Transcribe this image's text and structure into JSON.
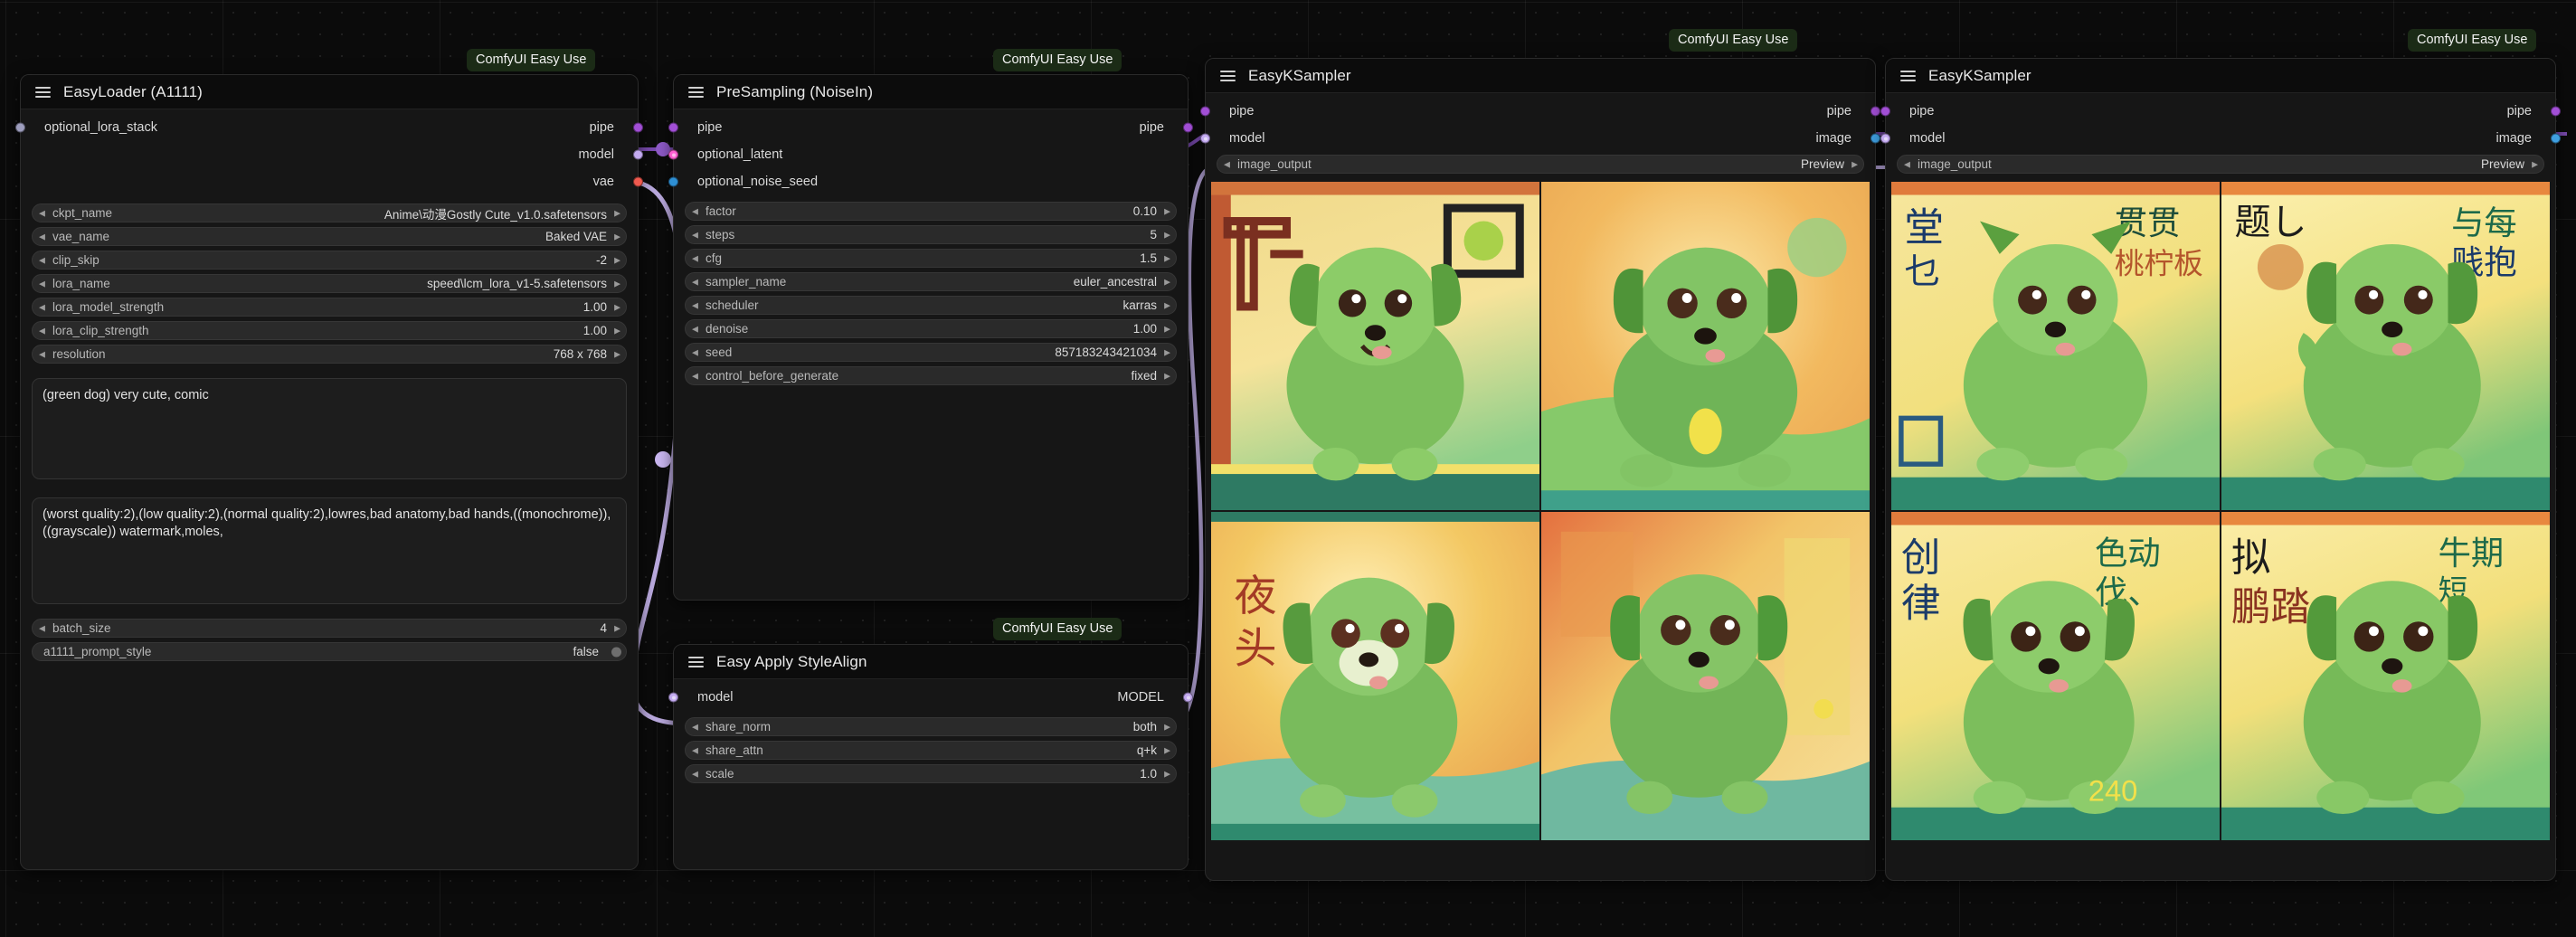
{
  "canvas": {
    "badge_label": "ComfyUI Easy Use"
  },
  "nodes": [
    {
      "id": "easyloader",
      "title": "EasyLoader (A1111)",
      "inputs": [
        {
          "name": "optional_lora_stack",
          "color": "#9d9dbd"
        }
      ],
      "outputs": [
        {
          "name": "pipe",
          "color": "#a24fd6"
        },
        {
          "name": "model",
          "color": "#c3aaf0"
        },
        {
          "name": "vae",
          "color": "#f05a4f"
        }
      ],
      "widgets": [
        {
          "name": "ckpt_name",
          "value": "Anime\\动漫Gostly Cute_v1.0.safetensors"
        },
        {
          "name": "vae_name",
          "value": "Baked VAE"
        },
        {
          "name": "clip_skip",
          "value": "-2"
        },
        {
          "name": "lora_name",
          "value": "speed\\lcm_lora_v1-5.safetensors"
        },
        {
          "name": "lora_model_strength",
          "value": "1.00"
        },
        {
          "name": "lora_clip_strength",
          "value": "1.00"
        },
        {
          "name": "resolution",
          "value": "768 x 768"
        }
      ],
      "positive_prompt": "(green dog) very cute, comic",
      "negative_prompt": "(worst quality:2),(low quality:2),(normal quality:2),lowres,bad anatomy,bad hands,((monochrome)),((grayscale)) watermark,moles,",
      "batch": {
        "name": "batch_size",
        "value": "4"
      },
      "toggle": {
        "name": "a1111_prompt_style",
        "value": "false"
      }
    },
    {
      "id": "presampling",
      "title": "PreSampling (NoiseIn)",
      "inputs": [
        {
          "name": "pipe",
          "color": "#a24fd6"
        },
        {
          "name": "optional_latent",
          "color": "#ff5fd2"
        },
        {
          "name": "optional_noise_seed",
          "color": "#2e8fd4"
        }
      ],
      "outputs": [
        {
          "name": "pipe",
          "color": "#a24fd6"
        }
      ],
      "widgets": [
        {
          "name": "factor",
          "value": "0.10"
        },
        {
          "name": "steps",
          "value": "5"
        },
        {
          "name": "cfg",
          "value": "1.5"
        },
        {
          "name": "sampler_name",
          "value": "euler_ancestral"
        },
        {
          "name": "scheduler",
          "value": "karras"
        },
        {
          "name": "denoise",
          "value": "1.00"
        },
        {
          "name": "seed",
          "value": "857183243421034"
        },
        {
          "name": "control_before_generate",
          "value": "fixed"
        }
      ]
    },
    {
      "id": "stylealign",
      "title": "Easy Apply StyleAlign",
      "inputs": [
        {
          "name": "model",
          "color": "#c3aaf0"
        }
      ],
      "outputs": [
        {
          "name": "MODEL",
          "color": "#c3aaf0"
        }
      ],
      "widgets": [
        {
          "name": "share_norm",
          "value": "both"
        },
        {
          "name": "share_attn",
          "value": "q+k"
        },
        {
          "name": "scale",
          "value": "1.0"
        }
      ]
    },
    {
      "id": "ksampler1",
      "title": "EasyKSampler",
      "inputs": [
        {
          "name": "pipe",
          "color": "#a24fd6"
        },
        {
          "name": "model",
          "color": "#c3aaf0"
        }
      ],
      "outputs": [
        {
          "name": "pipe",
          "color": "#a24fd6"
        },
        {
          "name": "image",
          "color": "#3f9fe0"
        }
      ],
      "widgets": [
        {
          "name": "image_output",
          "value": "Preview"
        }
      ],
      "preview_count": 4
    },
    {
      "id": "ksampler2",
      "title": "EasyKSampler",
      "inputs": [
        {
          "name": "pipe",
          "color": "#a24fd6"
        },
        {
          "name": "model",
          "color": "#c3aaf0"
        }
      ],
      "outputs": [
        {
          "name": "pipe",
          "color": "#a24fd6"
        },
        {
          "name": "image",
          "color": "#3f9fe0"
        }
      ],
      "widgets": [
        {
          "name": "image_output",
          "value": "Preview"
        }
      ],
      "preview_count": 4
    }
  ],
  "arrows": {
    "left": "◀",
    "right": "▶"
  },
  "colors": {
    "wire_pipe": "#7a4bb0",
    "wire_model": "#cbb8f2",
    "badge_bg": "#1b2b16",
    "node_bg": "#161616",
    "title_bg": "#0c0c0c"
  }
}
